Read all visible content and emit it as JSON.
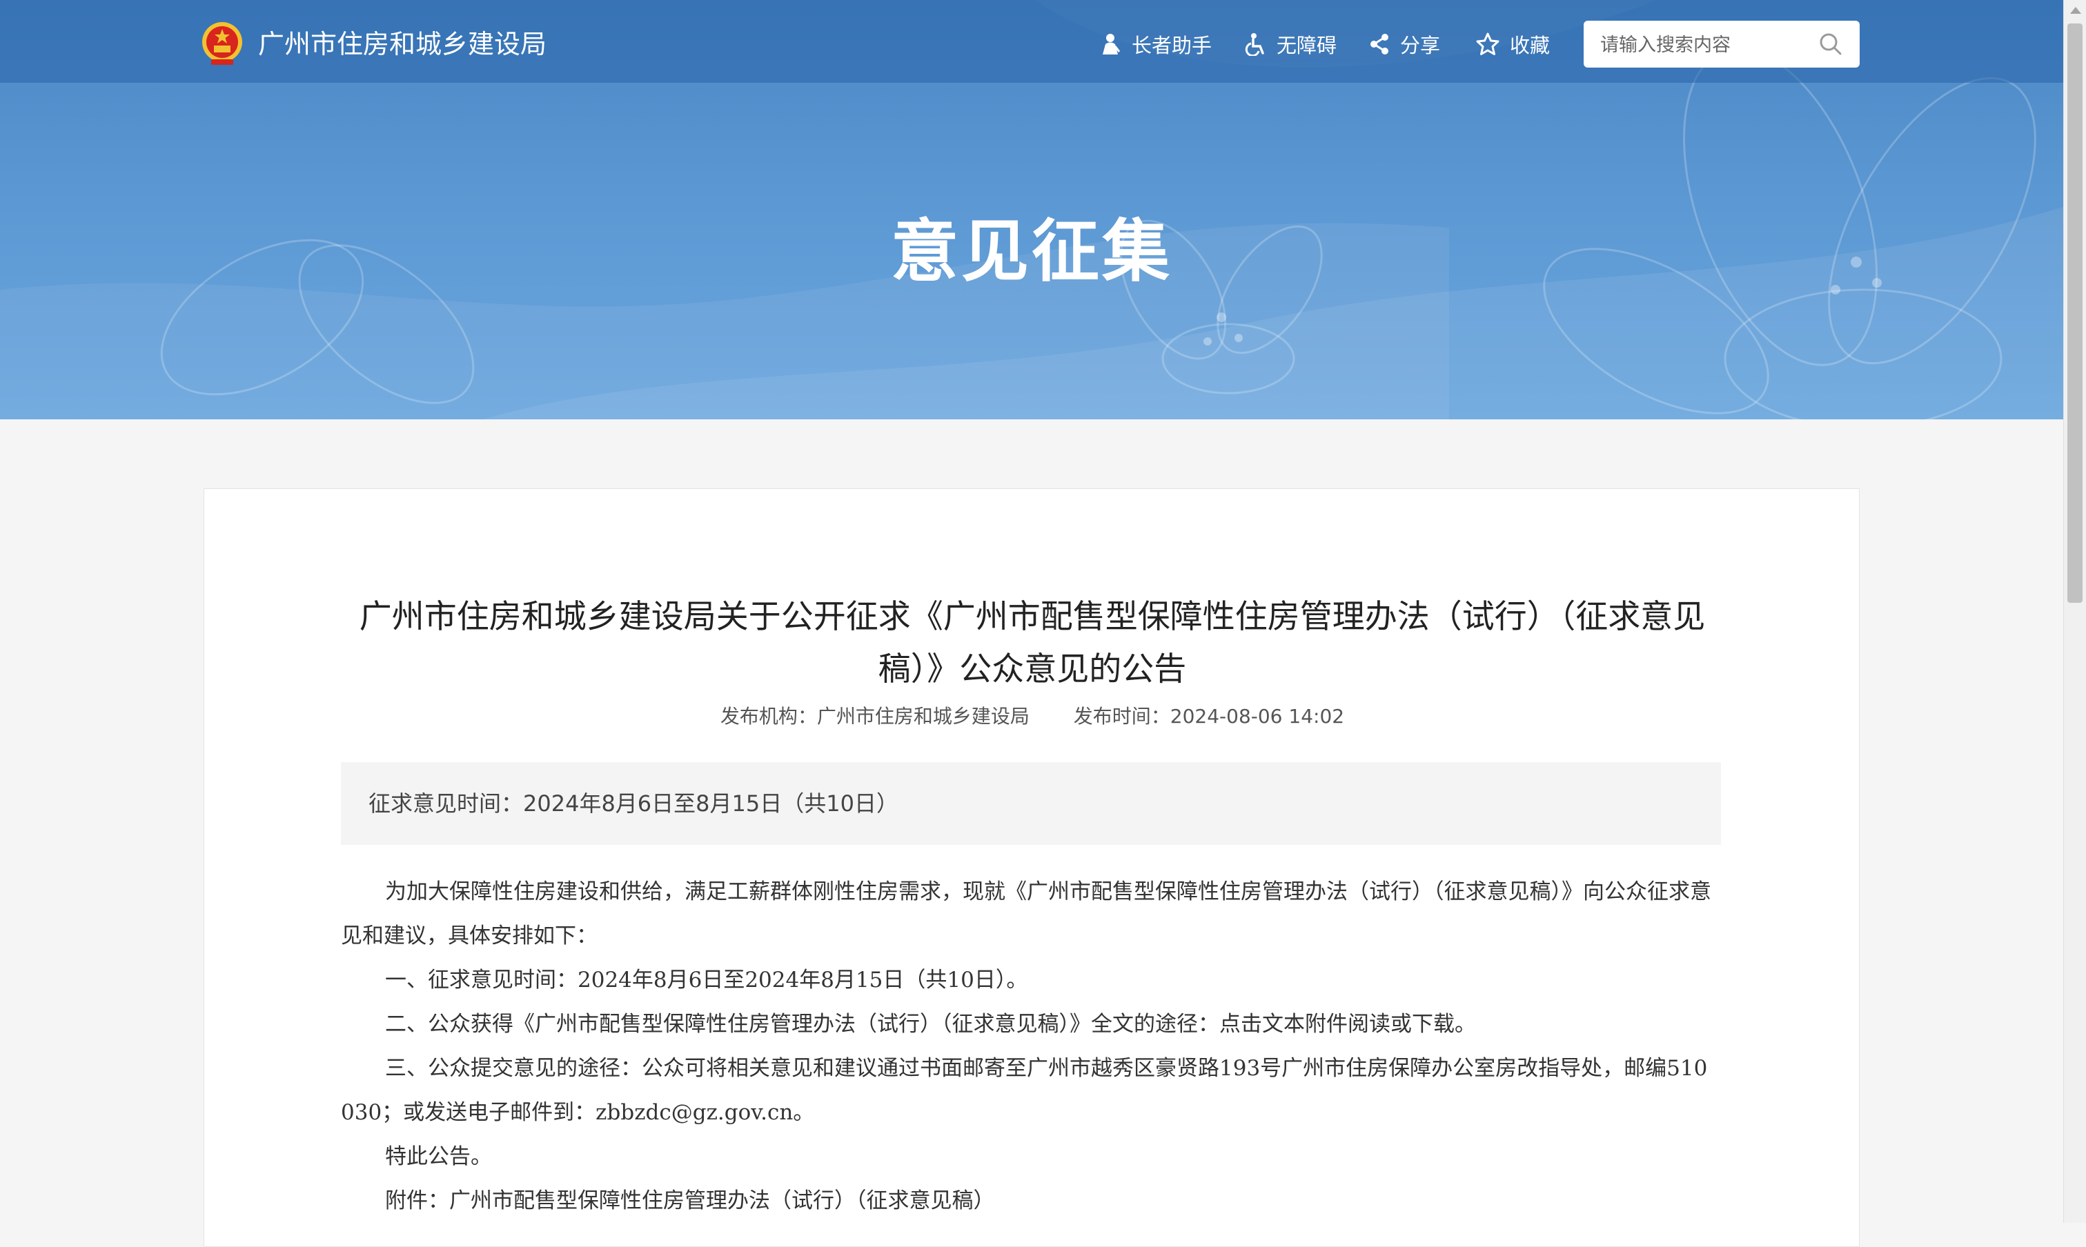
{
  "header": {
    "site_title": "广州市住房和城乡建设局",
    "tools": [
      {
        "label": "长者助手",
        "icon": "elder-helper-icon"
      },
      {
        "label": "无障碍",
        "icon": "accessibility-icon"
      },
      {
        "label": "分享",
        "icon": "share-icon"
      },
      {
        "label": "收藏",
        "icon": "star-icon"
      }
    ],
    "search": {
      "placeholder": "请输入搜索内容",
      "icon": "search-icon"
    }
  },
  "banner": {
    "title": "意见征集"
  },
  "article": {
    "title": "广州市住房和城乡建设局关于公开征求《广州市配售型保障性住房管理办法（试行）（征求意见稿）》公众意见的公告",
    "publisher_label": "发布机构：",
    "publisher": "广州市住房和城乡建设局",
    "time_label": "发布时间：",
    "time": "2024-08-06 14:02",
    "period": "征求意见时间：2024年8月6日至8月15日（共10日）",
    "paragraphs": [
      "为加大保障性住房建设和供给，满足工薪群体刚性住房需求，现就《广州市配售型保障性住房管理办法（试行）（征求意见稿）》向公众征求意见和建议，具体安排如下：",
      "一、征求意见时间：2024年8月6日至2024年8月15日（共10日）。",
      "二、公众获得《广州市配售型保障性住房管理办法（试行）（征求意见稿）》全文的途径：点击文本附件阅读或下载。",
      "三、公众提交意见的途径：公众可将相关意见和建议通过书面邮寄至广州市越秀区豪贤路193号广州市住房保障办公室房改指导处，邮编510030；或发送电子邮件到：zbbzdc@gz.gov.cn。",
      "特此公告。",
      "附件：广州市配售型保障性住房管理办法（试行）（征求意见稿）"
    ]
  },
  "colors": {
    "banner_top": "#4a86c4",
    "banner_bottom": "#6aa6de",
    "page_bg": "#f5f5f5",
    "period_bg": "#f4f4f4"
  }
}
